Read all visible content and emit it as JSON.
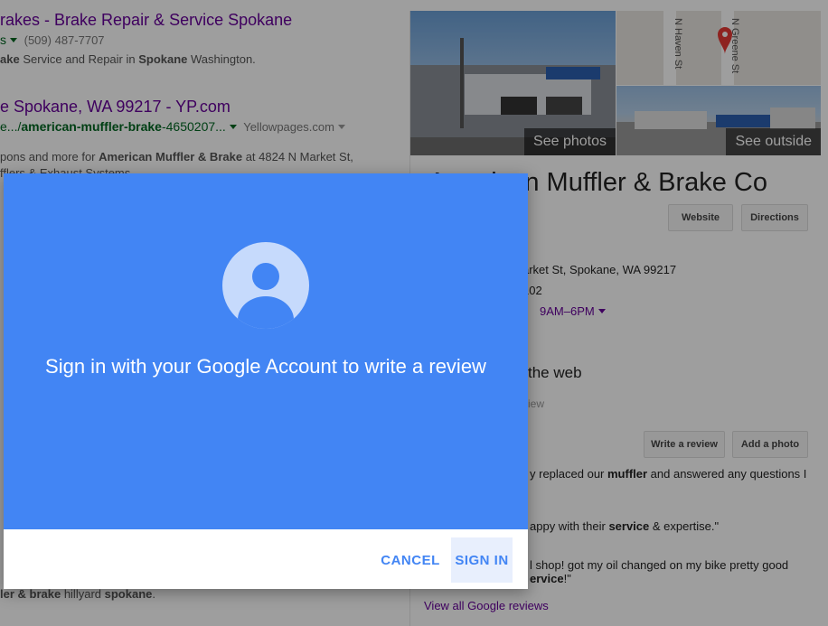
{
  "results": [
    {
      "title": "rakes - Brake Repair & Service Spokane",
      "url_prefix": "s",
      "phone": "(509) 487-7707",
      "snippet_a": "ake",
      "snippet_b": " Service and Repair in ",
      "snippet_c": "Spokane",
      "snippet_d": " Washington."
    },
    {
      "title": "e Spokane, WA 99217 - YP.com",
      "url_a": "e.../",
      "url_b": "american-muffler-brake",
      "url_c": "-4650207...",
      "source": "Yellowpages.com",
      "snippet_a": "pons and more for ",
      "snippet_b": "American Muffler & Brake",
      "snippet_c": " at 4824 N Market St,",
      "snippet_line2": "fflers & Exhaust Systems"
    }
  ],
  "left_fragments": {
    "bottom_a": "ler & brake",
    "bottom_b": " hillyard ",
    "bottom_c": "spokane",
    "bottom_d": "."
  },
  "knowledge_panel": {
    "see_photos": "See photos",
    "see_outside": "See outside",
    "map_street_1": "N Haven St",
    "map_street_2": "N Greene St",
    "title": "American Muffler & Brake Co",
    "website_button": "Website",
    "directions_button": "Directions",
    "address": "arket St, Spokane, WA 99217",
    "phone_fragment": "102",
    "hours": "9AM–6PM",
    "reviews_heading": "the web",
    "reviews_sub": "iew",
    "write_review_button": "Write a review",
    "add_photo_button": "Add a photo",
    "review1_a": "y replaced our ",
    "review1_b": "muffler",
    "review1_c": " and answered any questions I",
    "review2_a": "appy with their ",
    "review2_b": "service",
    "review2_c": " & expertise.\"",
    "review3_a": "l shop! got my oil changed on my bike pretty good",
    "review3_b": "ervice",
    "review3_c": "!\"",
    "view_all_link": "View all Google reviews"
  },
  "dialog": {
    "message": "Sign in with your Google Account to write a review",
    "cancel_label": "CANCEL",
    "sign_in_label": "SIGN IN"
  },
  "colors": {
    "dialog_blue": "#4285f4",
    "avatar_light": "#c6dafc",
    "link_visited": "#660099",
    "url_green": "#006621"
  }
}
